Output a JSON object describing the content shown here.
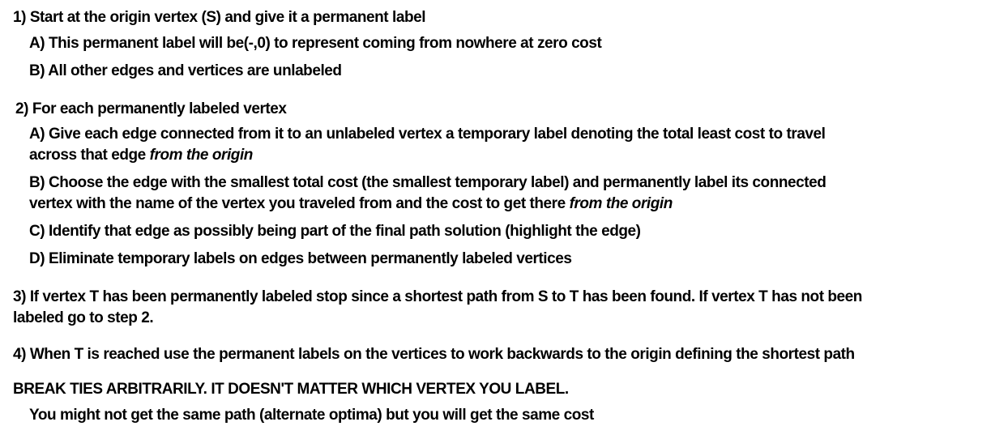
{
  "steps": {
    "s1": {
      "heading": "1) Start at the origin vertex (S) and give it a permanent label",
      "a": "A) This permanent label will be(-,0) to represent coming from nowhere at zero cost",
      "b": "B) All other edges and vertices are unlabeled"
    },
    "s2": {
      "heading": "2) For each permanently labeled vertex",
      "a_line1": "A) Give each edge connected from it to an unlabeled vertex a temporary label denoting the total least cost to travel",
      "a_line2": "across that edge ",
      "a_emph": "from the origin",
      "b_line1": "B) Choose the edge with the smallest total cost (the smallest temporary label) and permanently label its connected",
      "b_line2": "vertex with the name of the vertex you traveled from and the cost to get there ",
      "b_emph": "from the origin",
      "c": "C) Identify that edge as possibly being part of the final path solution (highlight the edge)",
      "d": "D) Eliminate temporary labels on edges between permanently labeled vertices"
    },
    "s3": {
      "line1": "3) If vertex T has been permanently labeled stop since a shortest path from S to T has been found. If vertex T has not been",
      "line2": "labeled go to step 2."
    },
    "s4": {
      "text": "4) When T is reached use the permanent labels on the vertices to work backwards to the origin defining the shortest path"
    },
    "note": {
      "heading": "BREAK TIES ARBITRARILY. IT DOESN'T MATTER WHICH VERTEX YOU LABEL.",
      "sub": "You might not get the same path (alternate optima) but you will get the same cost"
    }
  }
}
